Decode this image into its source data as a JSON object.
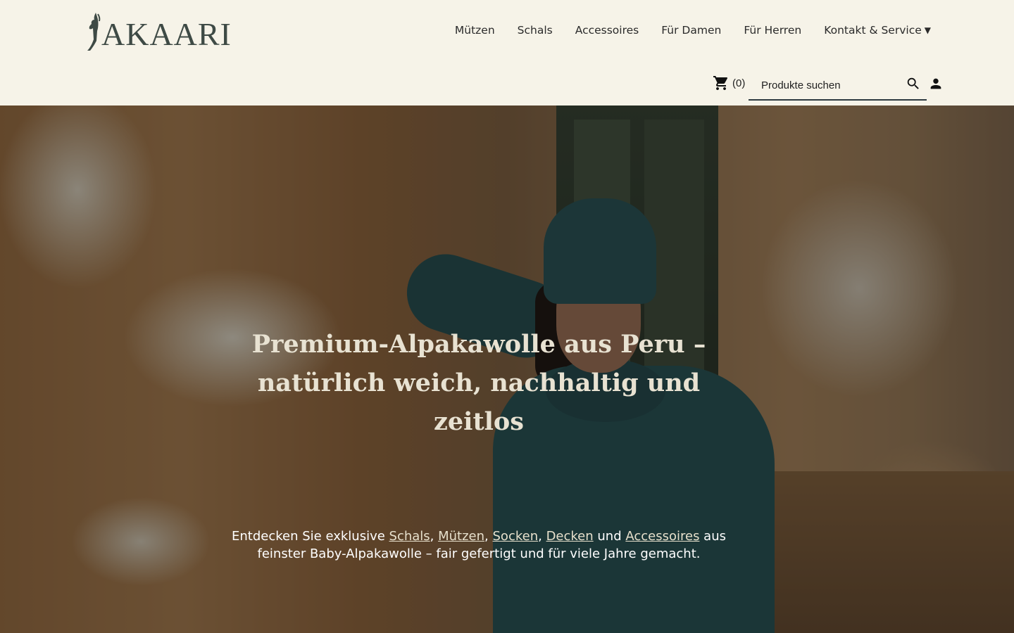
{
  "brand": {
    "name": "AKAARI",
    "logo_icon": "llama-icon",
    "text_color": "#3e4a45"
  },
  "nav": {
    "items": [
      {
        "label": "Mützen"
      },
      {
        "label": "Schals"
      },
      {
        "label": "Accessoires"
      },
      {
        "label": "Für Damen"
      },
      {
        "label": "Für Herren"
      },
      {
        "label": "Kontakt & Service",
        "dropdown": true
      }
    ]
  },
  "cart": {
    "icon": "cart-icon",
    "count": "(0)"
  },
  "search": {
    "placeholder": "Produkte suchen",
    "icon": "search-icon"
  },
  "account": {
    "icon": "user-icon"
  },
  "hero": {
    "title_line1": "Premium-Alpakawolle aus Peru –",
    "title_line2": "natürlich weich, nachhaltig und zeitlos",
    "text": {
      "intro": "Entdecken Sie exklusive ",
      "link_schals": "Schals",
      "sep1": ", ",
      "link_muetzen": "Mützen",
      "sep2": ", ",
      "link_socken": "Socken",
      "sep3": ", ",
      "link_decken": "Decken",
      "and": " und ",
      "link_accessoires": "Accessoires",
      "outro": " aus feinster Baby-Alpakawolle – fair gefertigt und für viele Jahre gemacht."
    }
  },
  "colors": {
    "header_bg": "#f6f3e8",
    "accent_dark": "#2d3a40",
    "hero_overlay": "rgba(0,0,0,0.40)"
  }
}
